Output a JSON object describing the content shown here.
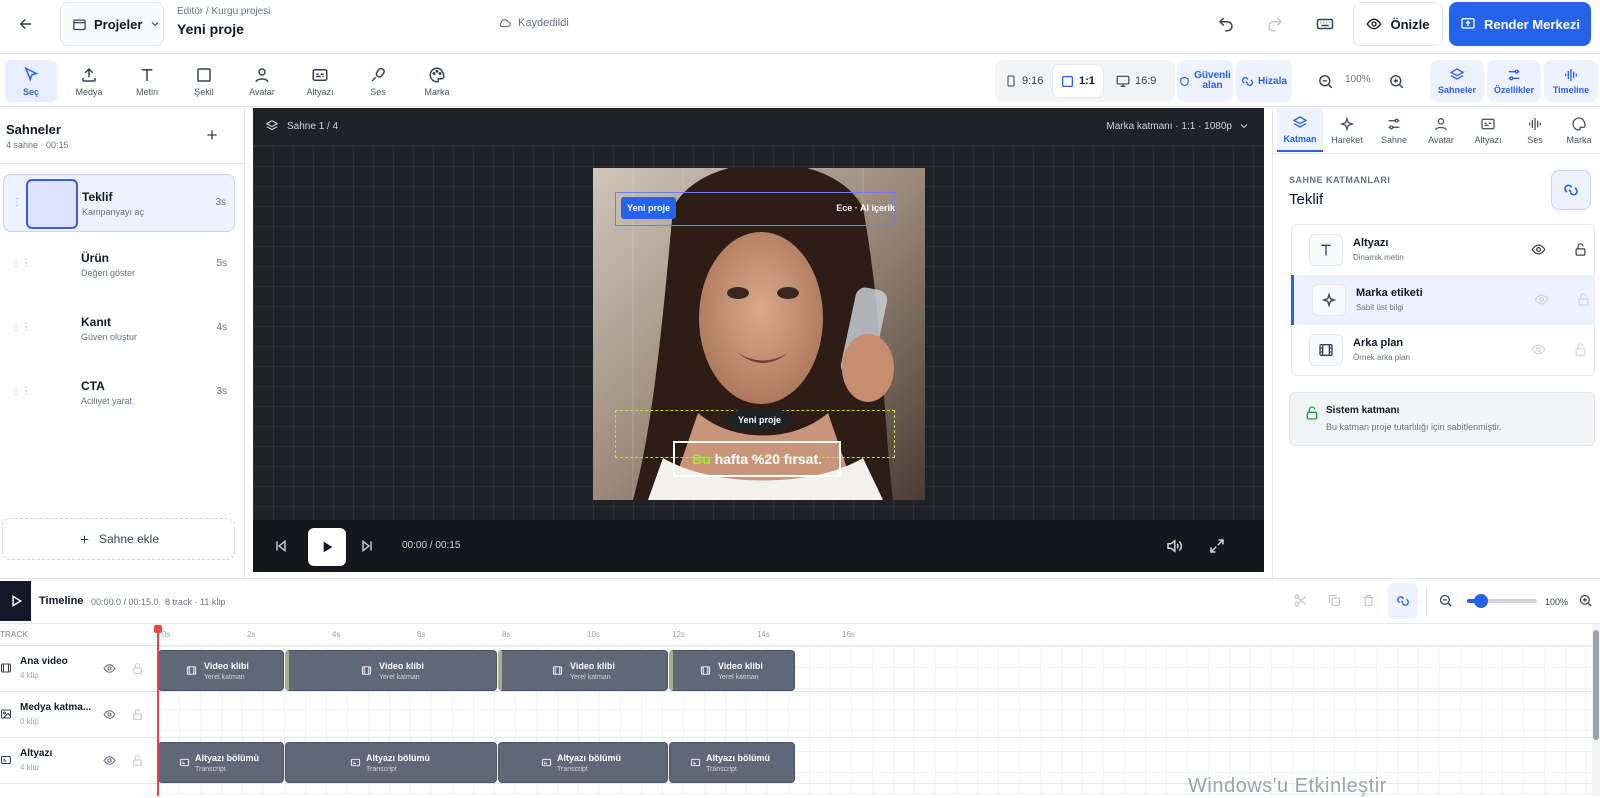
{
  "header": {
    "projects_label": "Projeler",
    "breadcrumb": "Editör / Kurgu projesi",
    "title": "Yeni proje",
    "save_status": "Kaydedildi",
    "preview_label": "Önizle",
    "render_label": "Render Merkezi"
  },
  "toolbar": {
    "tools": [
      {
        "label": "Seç",
        "icon": "cursor-icon"
      },
      {
        "label": "Medya",
        "icon": "upload-icon"
      },
      {
        "label": "Metin",
        "icon": "text-icon"
      },
      {
        "label": "Şekil",
        "icon": "shape-icon"
      },
      {
        "label": "Avatar",
        "icon": "user-icon"
      },
      {
        "label": "Altyazı",
        "icon": "caption-icon"
      },
      {
        "label": "Ses",
        "icon": "mic-icon"
      },
      {
        "label": "Marka",
        "icon": "palette-icon"
      }
    ],
    "ratios": [
      "9:16",
      "1:1",
      "16:9"
    ],
    "safe_area_label": "Güvenli alan",
    "align_label": "Hizala",
    "zoom": "100%",
    "panels": [
      "Sahneler",
      "Özellikler",
      "Timeline"
    ]
  },
  "scenes": {
    "title": "Sahneler",
    "summary": "4 sahne · 00:15",
    "items": [
      {
        "name": "Teklif",
        "sub": "Kampanyayı aç",
        "duration": "3s"
      },
      {
        "name": "Ürün",
        "sub": "Değeri göster",
        "duration": "5s"
      },
      {
        "name": "Kanıt",
        "sub": "Güven oluştur",
        "duration": "4s"
      },
      {
        "name": "CTA",
        "sub": "Aciliyet yarat",
        "duration": "3s"
      }
    ],
    "add_label": "Sahne ekle"
  },
  "canvas": {
    "scene_indicator": "Sahne 1 / 4",
    "format": "Marka katmanı · 1:1 · 1080p",
    "brand_tag": "Yeni proje",
    "brand_right": "Ece · AI içerik",
    "name_tag": "Yeni proje",
    "caption_highlight": "Bu",
    "caption_rest": "hafta %20 fırsat.",
    "time": "00:00 / 00:15"
  },
  "inspector": {
    "tabs": [
      "Katman",
      "Hareket",
      "Sahne",
      "Avatar",
      "Altyazı",
      "Ses",
      "Marka"
    ],
    "section_label": "SAHNE KATMANLARI",
    "scene_name": "Teklif",
    "layers": [
      {
        "name": "Altyazı",
        "sub": "Dinamik metin"
      },
      {
        "name": "Marka etiketi",
        "sub": "Sabit üst bilgi"
      },
      {
        "name": "Arka plan",
        "sub": "Örnek arka plan"
      }
    ],
    "system_title": "Sistem katmanı",
    "system_desc": "Bu katman proje tutarlılığı için sabitlenmiştir."
  },
  "timeline": {
    "title": "Timeline",
    "time": "00:00.0 / 00:15.0",
    "stats": "8 track · 11 klip",
    "zoom": "100%",
    "track_header": "TRACK",
    "ticks": [
      "0s",
      "2s",
      "4s",
      "6s",
      "8s",
      "10s",
      "12s",
      "14s",
      "16s"
    ],
    "tracks": [
      {
        "name": "Ana video",
        "count": "4 klip",
        "clip_title": "Video klibi",
        "clip_sub": "Yerel katman"
      },
      {
        "name": "Medya katma...",
        "count": "0 klip",
        "clip_title": "",
        "clip_sub": ""
      },
      {
        "name": "Altyazı",
        "count": "4 klip",
        "clip_title": "Altyazı bölümü",
        "clip_sub": "Transcript"
      }
    ]
  },
  "watermark": "Windows'u Etkinleştir",
  "colors": {
    "accent": "#2563eb",
    "highlight": "#a3e635",
    "canvas_bg": "#1f2229",
    "clip": "#5f6878",
    "playhead": "#ef4444"
  }
}
